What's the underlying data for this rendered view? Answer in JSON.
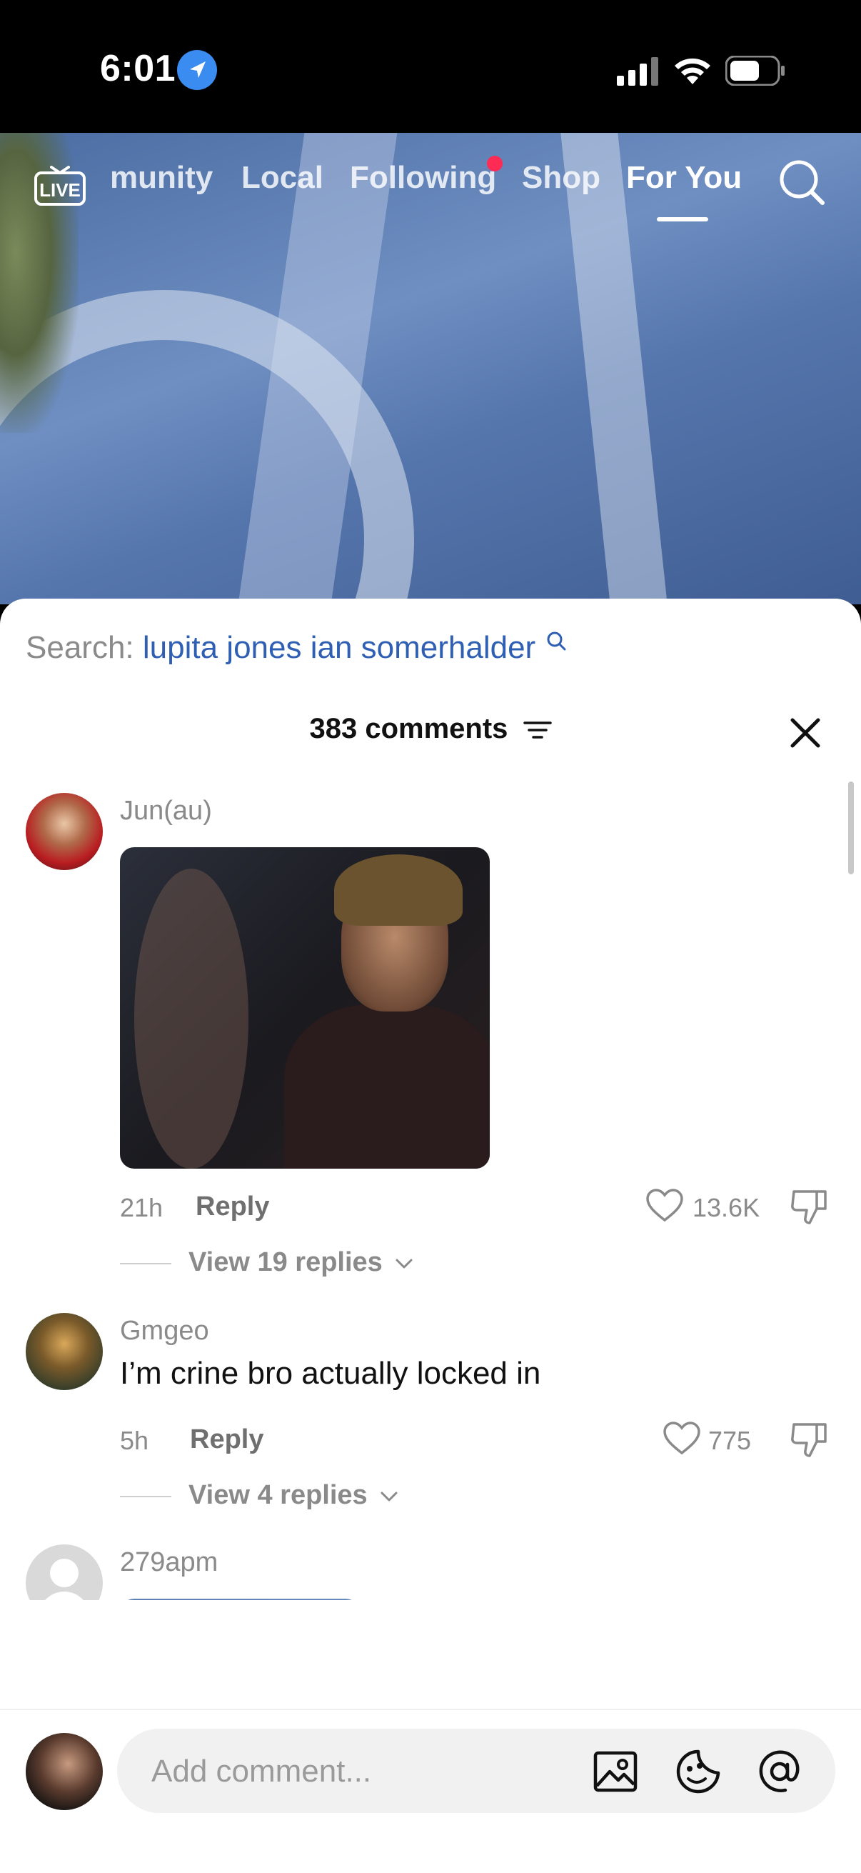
{
  "status_bar": {
    "time": "6:01"
  },
  "top_nav": {
    "items": [
      {
        "label": "munity"
      },
      {
        "label": "Local"
      },
      {
        "label": "Following"
      },
      {
        "label": "Shop"
      },
      {
        "label": "For You"
      }
    ],
    "active": "For You",
    "live_label": "LIVE"
  },
  "sheet": {
    "search_prefix": "Search:",
    "search_query": "lupita jones ian somerhalder",
    "comments_count": "383 comments"
  },
  "comments": [
    {
      "username": "Jun(au)",
      "text": "",
      "time": "21h",
      "reply_label": "Reply",
      "likes": "13.6K",
      "view_replies": "View 19 replies"
    },
    {
      "username": "Gmgeo",
      "text": "I’m crine bro actually locked in",
      "time": "5h",
      "reply_label": "Reply",
      "likes": "775",
      "view_replies": "View 4 replies"
    },
    {
      "username": "279apm",
      "text": ""
    }
  ],
  "input_bar": {
    "placeholder": "Add comment..."
  },
  "colors": {
    "accent_red": "#fe2c55",
    "link_blue": "#2f5fb3",
    "location_blue": "#3a8cf0"
  },
  "icons": [
    "location-arrow-icon",
    "signal-icon",
    "wifi-icon",
    "battery-icon",
    "live-icon",
    "search-icon",
    "filter-icon",
    "close-icon",
    "heart-icon",
    "dislike-icon",
    "chevron-down-icon",
    "image-icon",
    "emoji-sticker-icon",
    "mention-icon"
  ]
}
